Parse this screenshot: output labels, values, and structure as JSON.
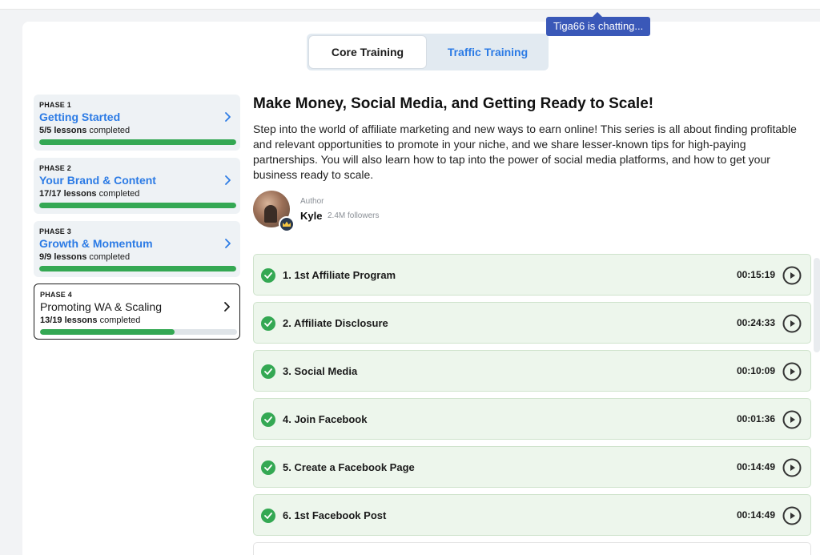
{
  "colors": {
    "accent": "#2c7be5",
    "success": "#34a853",
    "lesson_bg": "#edf6ec",
    "chat_bg": "#3a58b8"
  },
  "tabs": [
    {
      "label": "Core Training",
      "active": true
    },
    {
      "label": "Traffic Training",
      "active": false
    }
  ],
  "chat": {
    "text": "Tiga66 is chatting..."
  },
  "phases": [
    {
      "label": "PHASE 1",
      "title": "Getting Started",
      "progress_count": "5/5 lessons",
      "progress_suffix": "completed",
      "fraction": 1.0,
      "active": false,
      "icon": "chevron-right-icon"
    },
    {
      "label": "PHASE 2",
      "title": "Your Brand & Content",
      "progress_count": "17/17 lessons",
      "progress_suffix": "completed",
      "fraction": 1.0,
      "active": false,
      "icon": "chevron-right-icon"
    },
    {
      "label": "PHASE 3",
      "title": "Growth & Momentum",
      "progress_count": "9/9 lessons",
      "progress_suffix": "completed",
      "fraction": 1.0,
      "active": false,
      "icon": "chevron-right-icon"
    },
    {
      "label": "PHASE 4",
      "title": "Promoting WA & Scaling",
      "progress_count": "13/19 lessons",
      "progress_suffix": "completed",
      "fraction": 0.684,
      "active": true,
      "icon": "chevron-right-icon"
    }
  ],
  "course": {
    "title": "Make Money, Social Media, and Getting Ready to Scale!",
    "description": "Step into the world of affiliate marketing and new ways to earn online! This series is all about finding profitable and relevant opportunities to promote in your niche, and we share lesser-known tips for high-paying partnerships. You will also learn how to tap into the power of social media platforms, and how to get your business ready to scale.",
    "author_label": "Author",
    "author_name": "Kyle",
    "author_followers": "2.4M followers"
  },
  "lessons": [
    {
      "title": "1. 1st Affiliate Program",
      "duration": "00:15:19",
      "completed": true
    },
    {
      "title": "2. Affiliate Disclosure",
      "duration": "00:24:33",
      "completed": true
    },
    {
      "title": "3. Social Media",
      "duration": "00:10:09",
      "completed": true
    },
    {
      "title": "4. Join Facebook",
      "duration": "00:01:36",
      "completed": true
    },
    {
      "title": "5. Create a Facebook Page",
      "duration": "00:14:49",
      "completed": true
    },
    {
      "title": "6. 1st Facebook Post",
      "duration": "00:14:49",
      "completed": true
    }
  ]
}
